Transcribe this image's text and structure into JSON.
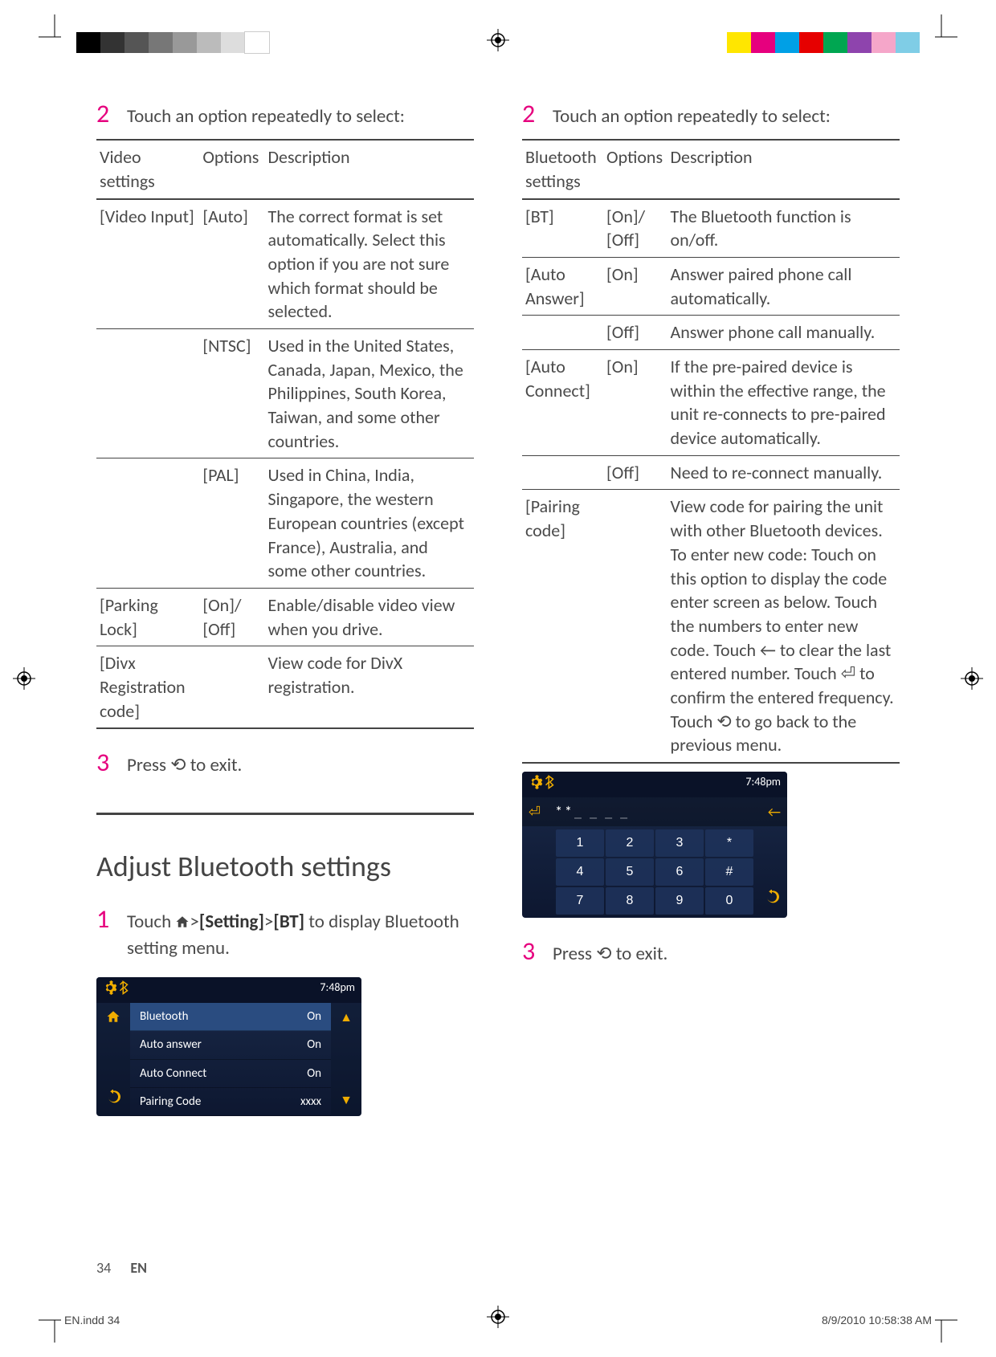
{
  "page": {
    "number": "34",
    "lang": "EN",
    "file": "EN.indd   34",
    "timestamp": "8/9/2010   10:58:38 AM"
  },
  "swatches_left": [
    "#000",
    "#333",
    "#555",
    "#777",
    "#999",
    "#bbb",
    "#ddd",
    "#fff"
  ],
  "swatches_right": [
    "#ffe600",
    "#e6007e",
    "#00a0e6",
    "#e60000",
    "#00a651",
    "#8e44ad",
    "#f5a6c9",
    "#7fcde6"
  ],
  "left": {
    "step2": "Touch an option repeatedly to select:",
    "headers": [
      "Video settings",
      "Options",
      "Description"
    ],
    "rows": [
      {
        "setting": "[Video Input]",
        "option": "[Auto]",
        "desc": "The correct format is set automatically. Select this option if you are not sure which format should be selected."
      },
      {
        "setting": "",
        "option": "[NTSC]",
        "desc": "Used in the United States, Canada, Japan, Mexico, the Philippines, South Korea, Taiwan, and some other countries."
      },
      {
        "setting": "",
        "option": "[PAL]",
        "desc": "Used in China, India, Singapore, the western European countries (except France), Australia, and some other countries."
      },
      {
        "setting": "[Parking Lock]",
        "option": "[On]/ [Off]",
        "desc": "Enable/disable video view when you drive."
      },
      {
        "setting": "[Divx Registration code]",
        "option": "",
        "desc": "View code for DivX registration."
      }
    ],
    "step3": "Press ⟲ to exit.",
    "section_title": "Adjust Bluetooth settings",
    "step1_pre": "Touch ",
    "step1_path1": "[Setting]",
    "step1_path2": "[BT]",
    "step1_post": " to display Bluetooth setting menu.",
    "screenshot": {
      "time": "7:48pm",
      "rows": [
        {
          "label": "Bluetooth",
          "value": "On",
          "selected": true
        },
        {
          "label": "Auto answer",
          "value": "On",
          "selected": false
        },
        {
          "label": "Auto Connect",
          "value": "On",
          "selected": false
        },
        {
          "label": "Pairing Code",
          "value": "xxxx",
          "selected": false
        }
      ]
    }
  },
  "right": {
    "step2": "Touch an option repeatedly to select:",
    "headers": [
      "Bluetooth settings",
      "Options",
      "Description"
    ],
    "rows": [
      {
        "setting": "[BT]",
        "option": "[On]/ [Off]",
        "desc": "The Bluetooth function is on/off."
      },
      {
        "setting": "[Auto Answer]",
        "option": "[On]",
        "desc": "Answer paired phone call automatically."
      },
      {
        "setting": "",
        "option": "[Off]",
        "desc": "Answer phone call manually."
      },
      {
        "setting": "[Auto Connect]",
        "option": "[On]",
        "desc": "If the pre-paired device is within the effective range, the unit re-connects to pre-paired device automatically."
      },
      {
        "setting": "",
        "option": "[Off]",
        "desc": "Need to re-connect manually."
      },
      {
        "setting": "[Pairing code]",
        "option": "",
        "desc": "View code for pairing the unit with other Bluetooth devices. To enter new code: Touch on this option to display the code enter screen as below. Touch the numbers to enter new code. Touch ← to clear the last entered number. Touch ⏎ to confirm the entered frequency. Touch ⟲ to go back to the previous menu."
      }
    ],
    "keypad": {
      "time": "7:48pm",
      "display": "**",
      "keys": [
        "1",
        "2",
        "3",
        "*",
        "4",
        "5",
        "6",
        "#",
        "7",
        "8",
        "9",
        "0"
      ]
    },
    "step3": "Press ⟲ to exit."
  }
}
